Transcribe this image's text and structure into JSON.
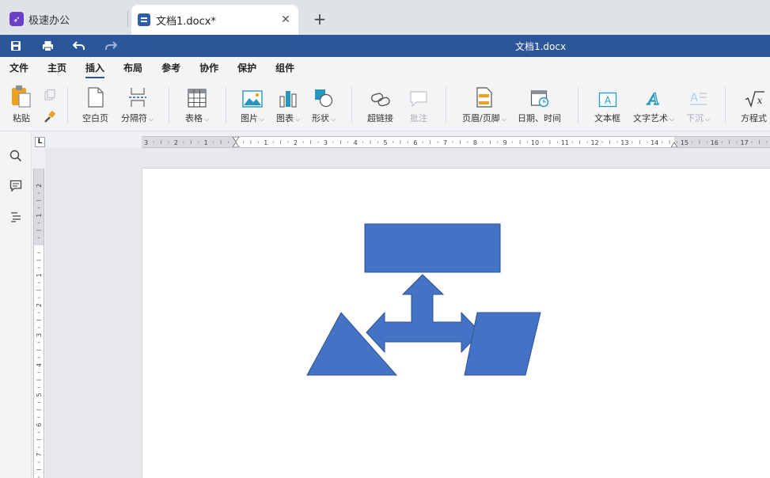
{
  "tabs": {
    "app_name": "极速办公",
    "doc_tab_label": "文档1.docx*",
    "close_glyph": "✕",
    "new_tab_glyph": "+"
  },
  "titlebar": {
    "title": "文档1.docx"
  },
  "menu": [
    "文件",
    "主页",
    "插入",
    "布局",
    "参考",
    "协作",
    "保护",
    "组件"
  ],
  "menu_active": "插入",
  "ribbon": {
    "paste": "粘贴",
    "blank_page": "空白页",
    "break": "分隔符",
    "table": "表格",
    "image": "图片",
    "chart": "图表",
    "shape": "形状",
    "hyperlink": "超链接",
    "comment": "批注",
    "header_footer": "页眉/页脚",
    "date_time": "日期、时间",
    "textbox": "文本框",
    "wordart": "文字艺术",
    "dropcap": "下沉",
    "equation": "方程式"
  },
  "ruler": {
    "corner": "L",
    "h_labels": [
      "3",
      "2",
      "1",
      "1",
      "2",
      "3",
      "4",
      "5",
      "6",
      "7",
      "8",
      "9",
      "10",
      "11",
      "12",
      "13",
      "14",
      "15",
      "16",
      "17"
    ],
    "v_labels": [
      "2",
      "1",
      "1",
      "2",
      "3",
      "4",
      "5",
      "6",
      "7"
    ]
  },
  "colors": {
    "accent": "#2b579a",
    "shape_fill": "#4472c4",
    "shape_stroke": "#2f528f",
    "app_icon": "#6b3fc6"
  }
}
